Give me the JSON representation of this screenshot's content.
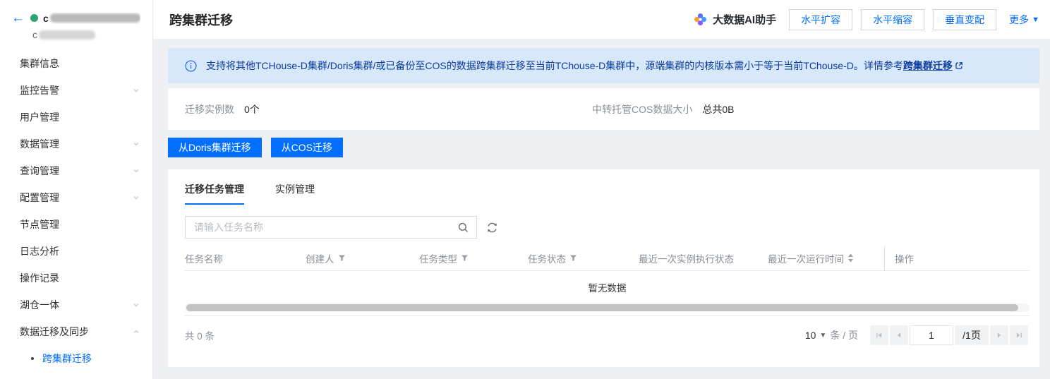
{
  "icons": {
    "back": "←",
    "more_caret": "▼",
    "page_caret": "▼"
  },
  "colors": {
    "accent": "#006eff",
    "banner_bg": "#d7e8fb",
    "banner_text": "#0d3c9e",
    "status_green": "#2ba471"
  },
  "topbar": {
    "cluster_name_prefix": "c",
    "cluster_sub_prefix": "c"
  },
  "sidebar": {
    "items": [
      {
        "label": "集群信息"
      },
      {
        "label": "监控告警"
      },
      {
        "label": "用户管理"
      },
      {
        "label": "数据管理"
      },
      {
        "label": "查询管理"
      },
      {
        "label": "配置管理"
      },
      {
        "label": "节点管理"
      },
      {
        "label": "日志分析"
      },
      {
        "label": "操作记录"
      },
      {
        "label": "湖仓一体"
      },
      {
        "label": "数据迁移及同步"
      }
    ],
    "subitems": [
      {
        "label": "跨集群迁移"
      }
    ]
  },
  "header": {
    "title": "跨集群迁移",
    "ai_assistant_label": "大数据AI助手",
    "buttons": [
      {
        "label": "水平扩容"
      },
      {
        "label": "水平缩容"
      },
      {
        "label": "垂直变配"
      }
    ],
    "more_label": "更多"
  },
  "banner": {
    "text": "支持将其他TCHouse-D集群/Doris集群/或已备份至COS的数据跨集群迁移至当前TChouse-D集群中，源端集群的内核版本需小于等于当前TChouse-D。详情参考",
    "link_label": "跨集群迁移"
  },
  "stats": {
    "items": [
      {
        "label": "迁移实例数",
        "value": "0个"
      },
      {
        "label": "中转托管COS数据大小",
        "value": "总共0B"
      }
    ]
  },
  "migrate_buttons": [
    {
      "label": "从Doris集群迁移"
    },
    {
      "label": "从COS迁移"
    }
  ],
  "tabs": [
    {
      "label": "迁移任务管理"
    },
    {
      "label": "实例管理"
    }
  ],
  "search": {
    "placeholder": "请输入任务名称"
  },
  "table": {
    "headers": [
      {
        "label": "任务名称"
      },
      {
        "label": "创建人"
      },
      {
        "label": "任务类型"
      },
      {
        "label": "任务状态"
      },
      {
        "label": "最近一次实例执行状态"
      },
      {
        "label": "最近一次运行时间"
      },
      {
        "label": "操作"
      }
    ],
    "empty_text": "暂无数据"
  },
  "pagination": {
    "total_text": "共 0 条",
    "page_size": "10",
    "unit_text": "条 / 页",
    "current_page": "1",
    "page_count_text": "/1页"
  }
}
